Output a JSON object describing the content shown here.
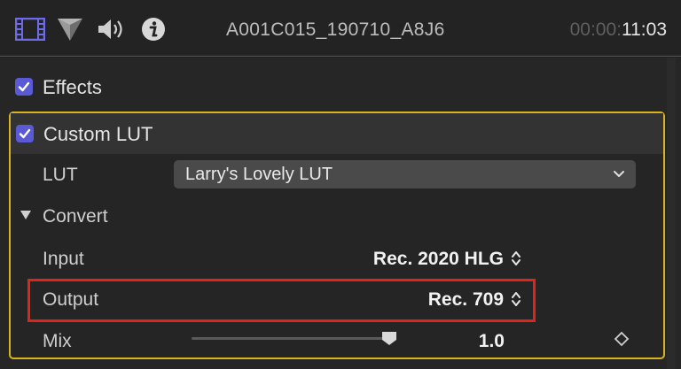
{
  "header": {
    "clip_name": "A001C015_190710_A8J6",
    "timecode_dim": "00:00:",
    "timecode_main": "11:03",
    "icons": [
      "film-icon",
      "color-icon",
      "speaker-icon",
      "info-icon"
    ],
    "accent_color": "#5b5ad6"
  },
  "effects": {
    "label": "Effects",
    "checked": true
  },
  "custom_lut": {
    "title": "Custom LUT",
    "checked": true,
    "highlight_color": "#d8b420",
    "lut_label": "LUT",
    "lut_value": "Larry's Lovely LUT",
    "convert_label": "Convert",
    "input_label": "Input",
    "input_value": "Rec. 2020 HLG",
    "output_label": "Output",
    "output_value": "Rec. 709",
    "output_highlight_color": "#e2231a",
    "mix_label": "Mix",
    "mix_value": "1.0"
  }
}
